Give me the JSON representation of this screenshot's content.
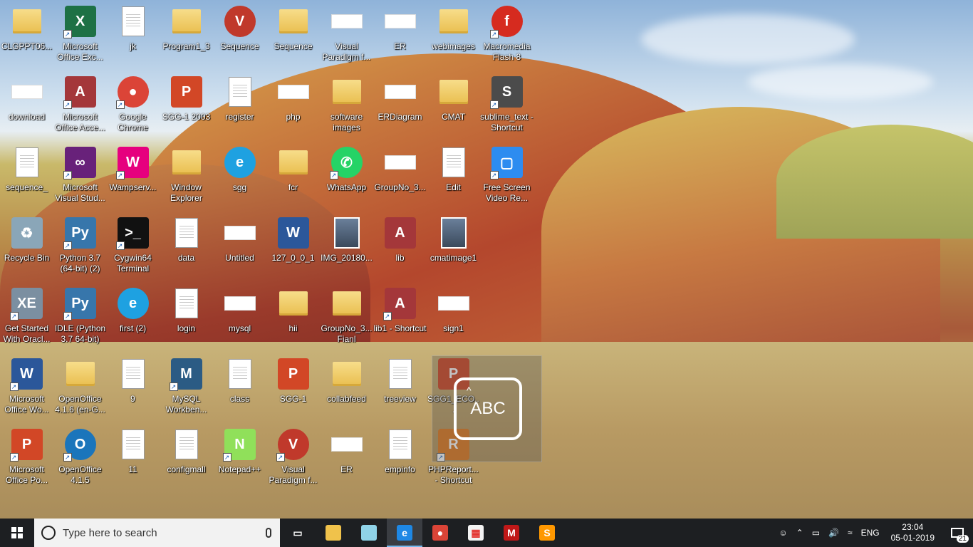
{
  "desktop": {
    "icons": [
      {
        "label": "CLGPPT06...",
        "icon": "folder-icon",
        "shortcut": false
      },
      {
        "label": "Microsoft Office Exc...",
        "icon": "excel-icon",
        "shortcut": true
      },
      {
        "label": "jk",
        "icon": "pdf-icon",
        "shortcut": false
      },
      {
        "label": "Program1_3",
        "icon": "folder-icon",
        "shortcut": false
      },
      {
        "label": "Sequence",
        "icon": "visual-paradigm-icon",
        "shortcut": false
      },
      {
        "label": "Sequence",
        "icon": "folder-icon",
        "shortcut": false
      },
      {
        "label": "Visual Paradigm f...",
        "icon": "image-file-icon",
        "shortcut": false
      },
      {
        "label": "ER",
        "icon": "image-file-icon",
        "shortcut": false
      },
      {
        "label": "webimages",
        "icon": "folder-icon",
        "shortcut": false
      },
      {
        "label": "Macromedia Flash 8",
        "icon": "flash-icon",
        "shortcut": true
      },
      {
        "label": "download",
        "icon": "image-file-icon",
        "shortcut": false
      },
      {
        "label": "Microsoft Office Acce...",
        "icon": "access-icon",
        "shortcut": true
      },
      {
        "label": "Google Chrome",
        "icon": "chrome-icon",
        "shortcut": true
      },
      {
        "label": "SGG-1 2003",
        "icon": "powerpoint-file-icon",
        "shortcut": false
      },
      {
        "label": "register",
        "icon": "text-file-icon",
        "shortcut": false
      },
      {
        "label": "php",
        "icon": "image-file-icon",
        "shortcut": false
      },
      {
        "label": "software images",
        "icon": "folder-icon",
        "shortcut": false
      },
      {
        "label": "ERDiagram",
        "icon": "image-file-icon",
        "shortcut": false
      },
      {
        "label": "CMAT",
        "icon": "folder-icon",
        "shortcut": false
      },
      {
        "label": "sublime_text - Shortcut",
        "icon": "sublime-icon",
        "shortcut": true
      },
      {
        "label": "sequence_",
        "icon": "pdf-icon",
        "shortcut": false
      },
      {
        "label": "Microsoft Visual Stud...",
        "icon": "visual-studio-icon",
        "shortcut": true
      },
      {
        "label": "Wampserv...",
        "icon": "wampserver-icon",
        "shortcut": true
      },
      {
        "label": "Window Explorer",
        "icon": "folder-icon",
        "shortcut": false
      },
      {
        "label": "sgg",
        "icon": "ie-icon",
        "shortcut": false
      },
      {
        "label": "fcr",
        "icon": "folder-icon",
        "shortcut": false
      },
      {
        "label": "WhatsApp",
        "icon": "whatsapp-icon",
        "shortcut": true
      },
      {
        "label": "GroupNo_3...",
        "icon": "image-file-icon",
        "shortcut": false
      },
      {
        "label": "Edit",
        "icon": "text-file-icon",
        "shortcut": false
      },
      {
        "label": "Free Screen Video Re...",
        "icon": "screen-recorder-icon",
        "shortcut": true
      },
      {
        "label": "Recycle Bin",
        "icon": "recycle-bin-icon",
        "shortcut": false
      },
      {
        "label": "Python 3.7 (64-bit) (2)",
        "icon": "python-icon",
        "shortcut": true
      },
      {
        "label": "Cygwin64 Terminal",
        "icon": "cygwin-icon",
        "shortcut": true
      },
      {
        "label": "data",
        "icon": "text-file-icon",
        "shortcut": false
      },
      {
        "label": "Untitled",
        "icon": "image-file-icon",
        "shortcut": false
      },
      {
        "label": "127_0_0_1",
        "icon": "word-file-icon",
        "shortcut": false
      },
      {
        "label": "IMG_20180...",
        "icon": "photo-icon",
        "shortcut": false
      },
      {
        "label": "lib",
        "icon": "access-file-icon",
        "shortcut": false
      },
      {
        "label": "cmatimage1",
        "icon": "photo-icon",
        "shortcut": false
      },
      {
        "label": "Get Started With Oracl...",
        "icon": "oracle-xe-icon",
        "shortcut": true
      },
      {
        "label": "IDLE (Python 3.7 64-bit)",
        "icon": "idle-icon",
        "shortcut": true
      },
      {
        "label": "first (2)",
        "icon": "ie-icon",
        "shortcut": false
      },
      {
        "label": "login",
        "icon": "text-file-icon",
        "shortcut": false
      },
      {
        "label": "mysql",
        "icon": "image-file-icon",
        "shortcut": false
      },
      {
        "label": "hii",
        "icon": "folder-icon",
        "shortcut": false
      },
      {
        "label": "GroupNo_3... Fianl",
        "icon": "folder-icon",
        "shortcut": false
      },
      {
        "label": "lib1 - Shortcut",
        "icon": "access-file-icon",
        "shortcut": true
      },
      {
        "label": "sign1",
        "icon": "signature-image-icon",
        "shortcut": false
      },
      {
        "label": "Microsoft Office Wo...",
        "icon": "word-icon",
        "shortcut": true
      },
      {
        "label": "OpenOffice 4.1.6 (en-G...",
        "icon": "folder-icon",
        "shortcut": false
      },
      {
        "label": "9",
        "icon": "text-file-icon",
        "shortcut": false
      },
      {
        "label": "MySQL Workben...",
        "icon": "mysql-workbench-icon",
        "shortcut": true
      },
      {
        "label": "class",
        "icon": "pdf-icon",
        "shortcut": false
      },
      {
        "label": "SGG-1",
        "icon": "powerpoint-file-icon",
        "shortcut": false
      },
      {
        "label": "collabfeed",
        "icon": "folder-icon",
        "shortcut": false
      },
      {
        "label": "treeview",
        "icon": "text-file-icon",
        "shortcut": false
      },
      {
        "label": "SGG1_ECO...",
        "icon": "powerpoint-file-icon",
        "shortcut": false
      },
      {
        "label": "Microsoft Office Po...",
        "icon": "powerpoint-icon",
        "shortcut": true
      },
      {
        "label": "OpenOffice 4.1.5",
        "icon": "openoffice-icon",
        "shortcut": true
      },
      {
        "label": "11",
        "icon": "text-file-icon",
        "shortcut": false
      },
      {
        "label": "configmall",
        "icon": "text-file-icon",
        "shortcut": false
      },
      {
        "label": "Notepad++",
        "icon": "notepadpp-icon",
        "shortcut": true
      },
      {
        "label": "Visual Paradigm f...",
        "icon": "visual-paradigm-icon",
        "shortcut": true
      },
      {
        "label": "ER",
        "icon": "image-file-icon",
        "shortcut": false
      },
      {
        "label": "empinfo",
        "icon": "text-file-icon",
        "shortcut": false
      },
      {
        "label": "PHPReport... - Shortcut",
        "icon": "phpreport-icon",
        "shortcut": true
      }
    ]
  },
  "overlay": {
    "text": "ABC",
    "caret": "^"
  },
  "taskbar": {
    "search_placeholder": "Type here to search",
    "pinned": [
      {
        "name": "task-view-icon",
        "active": false
      },
      {
        "name": "file-explorer-icon",
        "active": false
      },
      {
        "name": "notepad-glass-icon",
        "active": false
      },
      {
        "name": "edge-icon",
        "active": true
      },
      {
        "name": "chrome-icon",
        "active": false
      },
      {
        "name": "store-icon",
        "active": false
      },
      {
        "name": "mcafee-icon",
        "active": false
      },
      {
        "name": "sublime-icon",
        "active": false
      }
    ],
    "tray": {
      "language": "ENG",
      "time": "23:04",
      "date": "05-01-2019",
      "notification_count": "21"
    }
  },
  "colors": {
    "taskbar": "#1d1f22",
    "taskbar_active_underline": "#76b9ed",
    "search_bg": "#f2f2f2"
  }
}
